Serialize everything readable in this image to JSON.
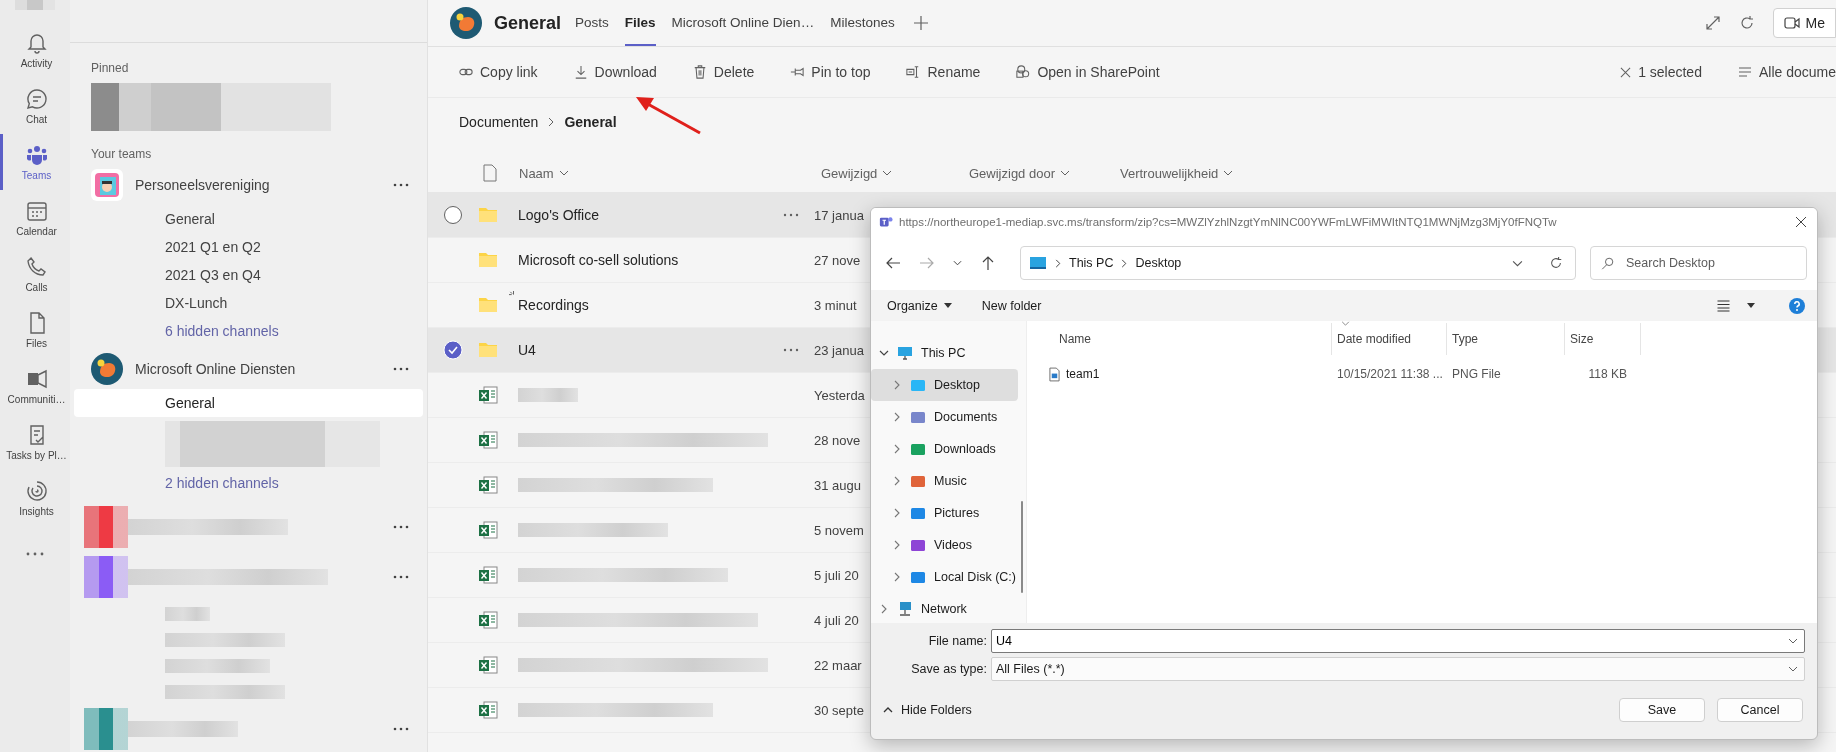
{
  "rail": {
    "items": [
      {
        "label": "Activity",
        "selected": false
      },
      {
        "label": "Chat",
        "selected": false
      },
      {
        "label": "Teams",
        "selected": true
      },
      {
        "label": "Calendar",
        "selected": false
      },
      {
        "label": "Calls",
        "selected": false
      },
      {
        "label": "Files",
        "selected": false
      },
      {
        "label": "Communiti…",
        "selected": false
      },
      {
        "label": "Tasks by Pl…",
        "selected": false
      },
      {
        "label": "Insights",
        "selected": false
      }
    ]
  },
  "sidebar": {
    "pinned_heading": "Pinned",
    "teams_heading": "Your teams",
    "teams": [
      {
        "name": "Personeelsvereniging",
        "channels": [
          {
            "name": "General",
            "selected": false
          },
          {
            "name": "2021 Q1 en Q2",
            "selected": false
          },
          {
            "name": "2021 Q3 en Q4",
            "selected": false
          },
          {
            "name": "DX-Lunch",
            "selected": false
          }
        ],
        "hidden_channels": "6 hidden channels"
      },
      {
        "name": "Microsoft Online Diensten",
        "channels": [
          {
            "name": "General",
            "selected": true
          }
        ],
        "hidden_channels": "2 hidden channels"
      }
    ]
  },
  "header": {
    "channel": "General",
    "tabs": [
      {
        "label": "Posts",
        "selected": false
      },
      {
        "label": "Files",
        "selected": true
      },
      {
        "label": "Microsoft Online Dien…",
        "selected": false
      },
      {
        "label": "Milestones",
        "selected": false
      }
    ],
    "meet_button": "Me"
  },
  "toolbar": {
    "actions": [
      "Copy link",
      "Download",
      "Delete",
      "Pin to top",
      "Rename",
      "Open in SharePoint"
    ],
    "selection": "1 selected",
    "view": "Alle docume"
  },
  "breadcrumb": [
    "Documenten",
    "General"
  ],
  "table": {
    "columns": [
      "Naam",
      "Gewijzigd",
      "Gewijzigd door",
      "Vertrouwelijkheid"
    ],
    "rows": [
      {
        "kind": "folder",
        "name": "Logo's Office",
        "modified": "17 janua",
        "selected": false,
        "hovered": true,
        "syncing": false
      },
      {
        "kind": "folder",
        "name": "Microsoft co-sell solutions",
        "modified": "27 nove",
        "selected": false,
        "hovered": false,
        "syncing": false
      },
      {
        "kind": "folder",
        "name": "Recordings",
        "modified": "3 minut",
        "selected": false,
        "hovered": false,
        "syncing": true
      },
      {
        "kind": "folder",
        "name": "U4",
        "modified": "23 janua",
        "selected": true,
        "hovered": false,
        "syncing": false
      },
      {
        "kind": "excel",
        "modified": "Yesterda",
        "selected": false,
        "hovered": false,
        "syncing": false
      },
      {
        "kind": "excel",
        "modified": "28 nove",
        "selected": false,
        "hovered": false,
        "syncing": false
      },
      {
        "kind": "excel",
        "modified": "31 augu",
        "selected": false,
        "hovered": false,
        "syncing": false
      },
      {
        "kind": "excel",
        "modified": "5 novem",
        "selected": false,
        "hovered": false,
        "syncing": false
      },
      {
        "kind": "excel",
        "modified": "5 juli 20",
        "selected": false,
        "hovered": false,
        "syncing": false
      },
      {
        "kind": "excel",
        "modified": "4 juli 20",
        "selected": false,
        "hovered": false,
        "syncing": false
      },
      {
        "kind": "excel",
        "modified": "22 maar",
        "selected": false,
        "hovered": false,
        "syncing": false
      },
      {
        "kind": "excel",
        "modified": "30 septe",
        "selected": false,
        "hovered": false,
        "syncing": false
      }
    ]
  },
  "dialog": {
    "title": "https://northeurope1-mediap.svc.ms/transform/zip?cs=MWZlYzhlNzgtYmNlNC00YWFmLWFiMWItNTQ1MWNjMzg3MjY0fFNQTw",
    "path": [
      "This PC",
      "Desktop"
    ],
    "search_placeholder": "Search Desktop",
    "organize": "Organize",
    "new_folder": "New folder",
    "tree": [
      {
        "label": "This PC",
        "expanded": true,
        "selected": false,
        "children": [
          {
            "label": "Desktop",
            "expanded": false,
            "selected": true
          },
          {
            "label": "Documents",
            "expanded": false,
            "selected": false
          },
          {
            "label": "Downloads",
            "expanded": false,
            "selected": false
          },
          {
            "label": "Music",
            "expanded": false,
            "selected": false
          },
          {
            "label": "Pictures",
            "expanded": false,
            "selected": false
          },
          {
            "label": "Videos",
            "expanded": false,
            "selected": false
          },
          {
            "label": "Local Disk (C:)",
            "expanded": false,
            "selected": false
          }
        ]
      },
      {
        "label": "Network",
        "expanded": false,
        "selected": false
      }
    ],
    "columns": [
      "Name",
      "Date modified",
      "Type",
      "Size"
    ],
    "files": [
      {
        "name": "team1",
        "modified": "10/15/2021 11:38 ...",
        "type": "PNG File",
        "size": "118 KB"
      }
    ],
    "file_name_label": "File name:",
    "file_name": "U4",
    "type_label": "Save as type:",
    "file_type": "All Files (*.*)",
    "hide_folders": "Hide Folders",
    "save": "Save",
    "cancel": "Cancel"
  }
}
